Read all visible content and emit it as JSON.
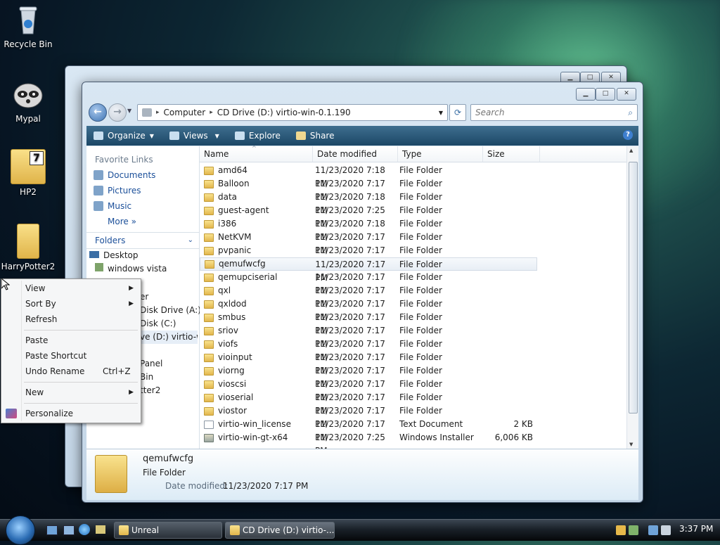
{
  "desktop": {
    "icons": [
      {
        "label": "Recycle Bin"
      },
      {
        "label": "Mypal"
      },
      {
        "label": "HP2"
      },
      {
        "label": "HarryPotter2"
      }
    ]
  },
  "explorer": {
    "address": {
      "segments": [
        "Computer",
        "CD Drive (D:) virtio-win-0.1.190"
      ],
      "search_placeholder": "Search"
    },
    "toolbar": {
      "organize": "Organize",
      "views": "Views",
      "explore": "Explore",
      "share": "Share"
    },
    "nav": {
      "favorite_links_title": "Favorite Links",
      "favorites": [
        "Documents",
        "Pictures",
        "Music"
      ],
      "more": "More",
      "folders_title": "Folders",
      "tree": [
        "Desktop",
        "windows vista",
        "er",
        "Disk Drive (A:)",
        "Disk (C:)",
        "ve (D:) virtio-wi",
        "Panel",
        "Bin",
        "tter2"
      ]
    },
    "columns": [
      "Name",
      "Date modified",
      "Type",
      "Size"
    ],
    "files": [
      {
        "name": "amd64",
        "date": "11/23/2020 7:18 PM",
        "type": "File Folder",
        "size": "",
        "kind": "folder"
      },
      {
        "name": "Balloon",
        "date": "11/23/2020 7:17 PM",
        "type": "File Folder",
        "size": "",
        "kind": "folder"
      },
      {
        "name": "data",
        "date": "11/23/2020 7:18 PM",
        "type": "File Folder",
        "size": "",
        "kind": "folder"
      },
      {
        "name": "guest-agent",
        "date": "11/23/2020 7:25 PM",
        "type": "File Folder",
        "size": "",
        "kind": "folder"
      },
      {
        "name": "i386",
        "date": "11/23/2020 7:18 PM",
        "type": "File Folder",
        "size": "",
        "kind": "folder"
      },
      {
        "name": "NetKVM",
        "date": "11/23/2020 7:17 PM",
        "type": "File Folder",
        "size": "",
        "kind": "folder"
      },
      {
        "name": "pvpanic",
        "date": "11/23/2020 7:17 PM",
        "type": "File Folder",
        "size": "",
        "kind": "folder"
      },
      {
        "name": "qemufwcfg",
        "date": "11/23/2020 7:17 PM",
        "type": "File Folder",
        "size": "",
        "kind": "folder",
        "selected": true
      },
      {
        "name": "qemupciserial",
        "date": "11/23/2020 7:17 PM",
        "type": "File Folder",
        "size": "",
        "kind": "folder"
      },
      {
        "name": "qxl",
        "date": "11/23/2020 7:17 PM",
        "type": "File Folder",
        "size": "",
        "kind": "folder"
      },
      {
        "name": "qxldod",
        "date": "11/23/2020 7:17 PM",
        "type": "File Folder",
        "size": "",
        "kind": "folder"
      },
      {
        "name": "smbus",
        "date": "11/23/2020 7:17 PM",
        "type": "File Folder",
        "size": "",
        "kind": "folder"
      },
      {
        "name": "sriov",
        "date": "11/23/2020 7:17 PM",
        "type": "File Folder",
        "size": "",
        "kind": "folder"
      },
      {
        "name": "viofs",
        "date": "11/23/2020 7:17 PM",
        "type": "File Folder",
        "size": "",
        "kind": "folder"
      },
      {
        "name": "vioinput",
        "date": "11/23/2020 7:17 PM",
        "type": "File Folder",
        "size": "",
        "kind": "folder"
      },
      {
        "name": "viorng",
        "date": "11/23/2020 7:17 PM",
        "type": "File Folder",
        "size": "",
        "kind": "folder"
      },
      {
        "name": "vioscsi",
        "date": "11/23/2020 7:17 PM",
        "type": "File Folder",
        "size": "",
        "kind": "folder"
      },
      {
        "name": "vioserial",
        "date": "11/23/2020 7:17 PM",
        "type": "File Folder",
        "size": "",
        "kind": "folder"
      },
      {
        "name": "viostor",
        "date": "11/23/2020 7:17 PM",
        "type": "File Folder",
        "size": "",
        "kind": "folder"
      },
      {
        "name": "virtio-win_license",
        "date": "11/23/2020 7:17 PM",
        "type": "Text Document",
        "size": "2 KB",
        "kind": "doc"
      },
      {
        "name": "virtio-win-gt-x64",
        "date": "11/23/2020 7:25 PM",
        "type": "Windows Installer ...",
        "size": "6,006 KB",
        "kind": "msi"
      }
    ],
    "details": {
      "name": "qemufwcfg",
      "type": "File Folder",
      "date_label": "Date modified:",
      "date_value": "11/23/2020 7:17 PM"
    }
  },
  "context_menu": {
    "items": [
      {
        "label": "View",
        "submenu": true
      },
      {
        "label": "Sort By",
        "submenu": true
      },
      {
        "label": "Refresh"
      },
      {
        "label": "Paste"
      },
      {
        "label": "Paste Shortcut"
      },
      {
        "label": "Undo Rename",
        "shortcut": "Ctrl+Z"
      },
      {
        "label": "New",
        "submenu": true
      },
      {
        "label": "Personalize"
      }
    ]
  },
  "taskbar": {
    "buttons": [
      "Unreal",
      "CD Drive (D:) virtio-..."
    ],
    "clock": "3:37 PM"
  }
}
